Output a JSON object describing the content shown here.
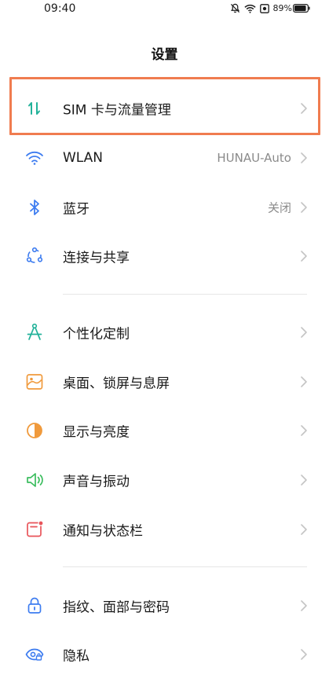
{
  "status_bar": {
    "time": "09:40",
    "battery_pct": "89%",
    "icons": [
      "mute-icon",
      "wifi-icon",
      "screen-record-icon",
      "battery-icon"
    ]
  },
  "header": {
    "title": "设置"
  },
  "colors": {
    "highlight": "#f07c4f",
    "accent_teal": "#23b29a",
    "accent_blue": "#3d7cf0",
    "accent_orange": "#f09a3c",
    "accent_green": "#3bbd5e",
    "accent_red": "#e8545a"
  },
  "settings": {
    "sim": {
      "label": "SIM 卡与流量管理",
      "value": ""
    },
    "wlan": {
      "label": "WLAN",
      "value": "HUNAU-Auto"
    },
    "bluetooth": {
      "label": "蓝牙",
      "value": "关闭"
    },
    "connection": {
      "label": "连接与共享",
      "value": ""
    },
    "personalize": {
      "label": "个性化定制",
      "value": ""
    },
    "desktop": {
      "label": "桌面、锁屏与息屏",
      "value": ""
    },
    "display": {
      "label": "显示与亮度",
      "value": ""
    },
    "sound": {
      "label": "声音与振动",
      "value": ""
    },
    "notification": {
      "label": "通知与状态栏",
      "value": ""
    },
    "security": {
      "label": "指纹、面部与密码",
      "value": ""
    },
    "privacy": {
      "label": "隐私",
      "value": ""
    }
  }
}
